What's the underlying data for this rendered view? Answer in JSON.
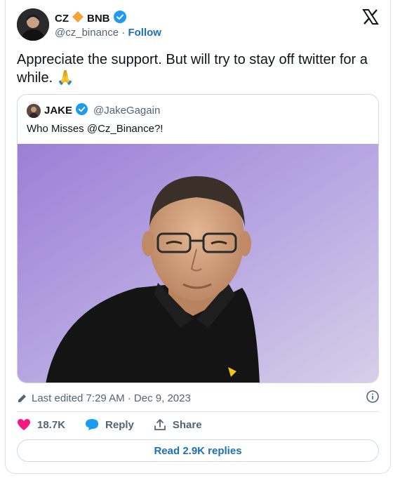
{
  "author": {
    "name": "CZ",
    "symbol": "BNB",
    "handle": "@cz_binance",
    "separator": "·",
    "follow": "Follow",
    "verified_color": "#1d9bf0",
    "diamond_color": "#f3a33a"
  },
  "tweet": {
    "text": "Appreciate the support. But will try to stay off twitter for a while. 🙏"
  },
  "quote": {
    "name": "JAKE",
    "handle": "@JakeGagain",
    "text": "Who Misses @Cz_Binance?!"
  },
  "meta": {
    "edited": "Last edited 7:29 AM · Dec 9, 2023"
  },
  "actions": {
    "likes": "18.7K",
    "reply": "Reply",
    "share": "Share",
    "like_color": "#f91880",
    "reply_color": "#1d9bf0"
  },
  "replies_button": "Read 2.9K replies",
  "icons": [
    "x-logo-icon",
    "verified-icon",
    "bnb-diamond-icon",
    "pencil-icon",
    "info-icon",
    "heart-icon",
    "reply-bubble-icon",
    "share-icon"
  ]
}
